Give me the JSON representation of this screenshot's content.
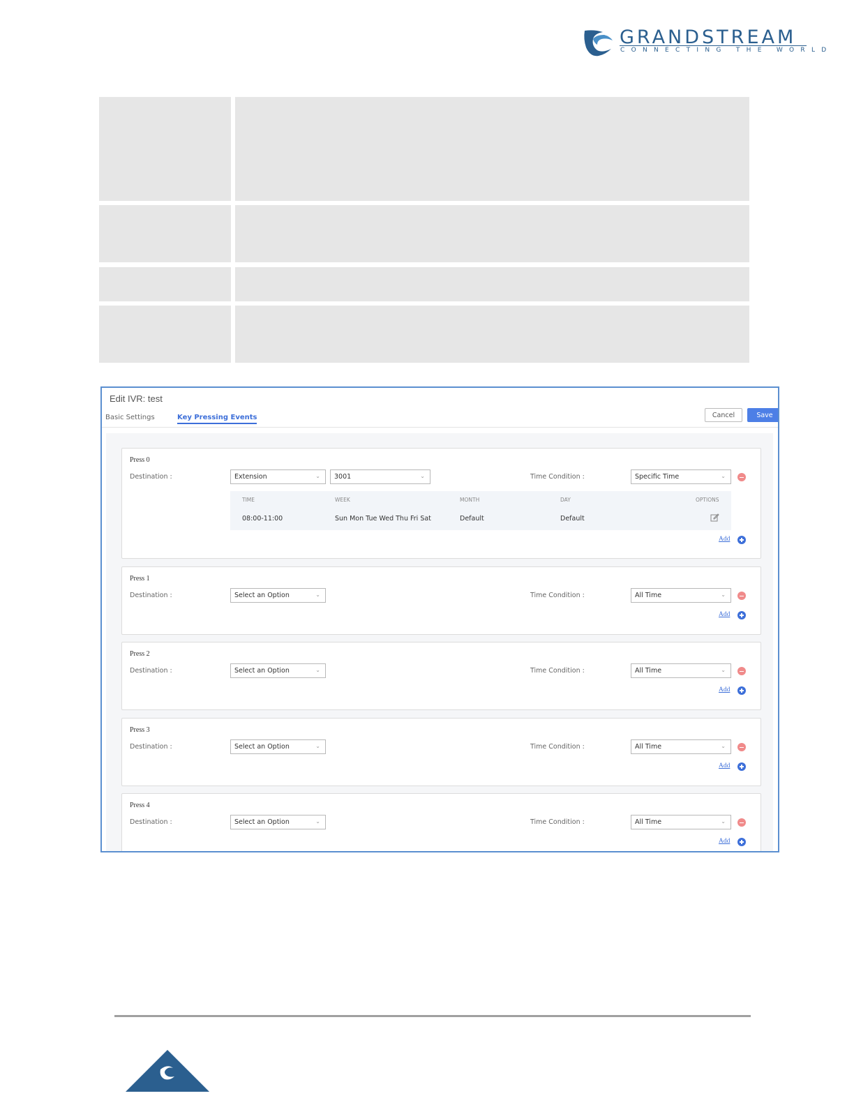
{
  "header": {
    "logo_word": "GRANDSTREAM",
    "logo_tagline": "CONNECTING THE WORLD",
    "brand_color": "#2b5f8f"
  },
  "panel": {
    "title": "Edit IVR: test",
    "tabs": [
      {
        "label": "Basic Settings",
        "active": false
      },
      {
        "label": "Key Pressing Events",
        "active": true
      }
    ],
    "cancel_label": "Cancel",
    "save_label": "Save",
    "accent_color": "#4d7fe6",
    "destination_label": "Destination :",
    "time_condition_label": "Time Condition :",
    "add_label": "Add",
    "press_items": [
      {
        "title": "Press 0",
        "destination": "Extension",
        "extension": "3001",
        "time_condition": "Specific Time",
        "time_table": {
          "headers": [
            "TIME",
            "WEEK",
            "MONTH",
            "DAY",
            "OPTIONS"
          ],
          "row": {
            "time": "08:00-11:00",
            "week": "Sun Mon Tue Wed Thu Fri Sat",
            "month": "Default",
            "day": "Default"
          }
        }
      },
      {
        "title": "Press 1",
        "destination": "Select an Option",
        "time_condition": "All Time"
      },
      {
        "title": "Press 2",
        "destination": "Select an Option",
        "time_condition": "All Time"
      },
      {
        "title": "Press 3",
        "destination": "Select an Option",
        "time_condition": "All Time"
      },
      {
        "title": "Press 4",
        "destination": "Select an Option",
        "time_condition": "All Time"
      }
    ]
  }
}
